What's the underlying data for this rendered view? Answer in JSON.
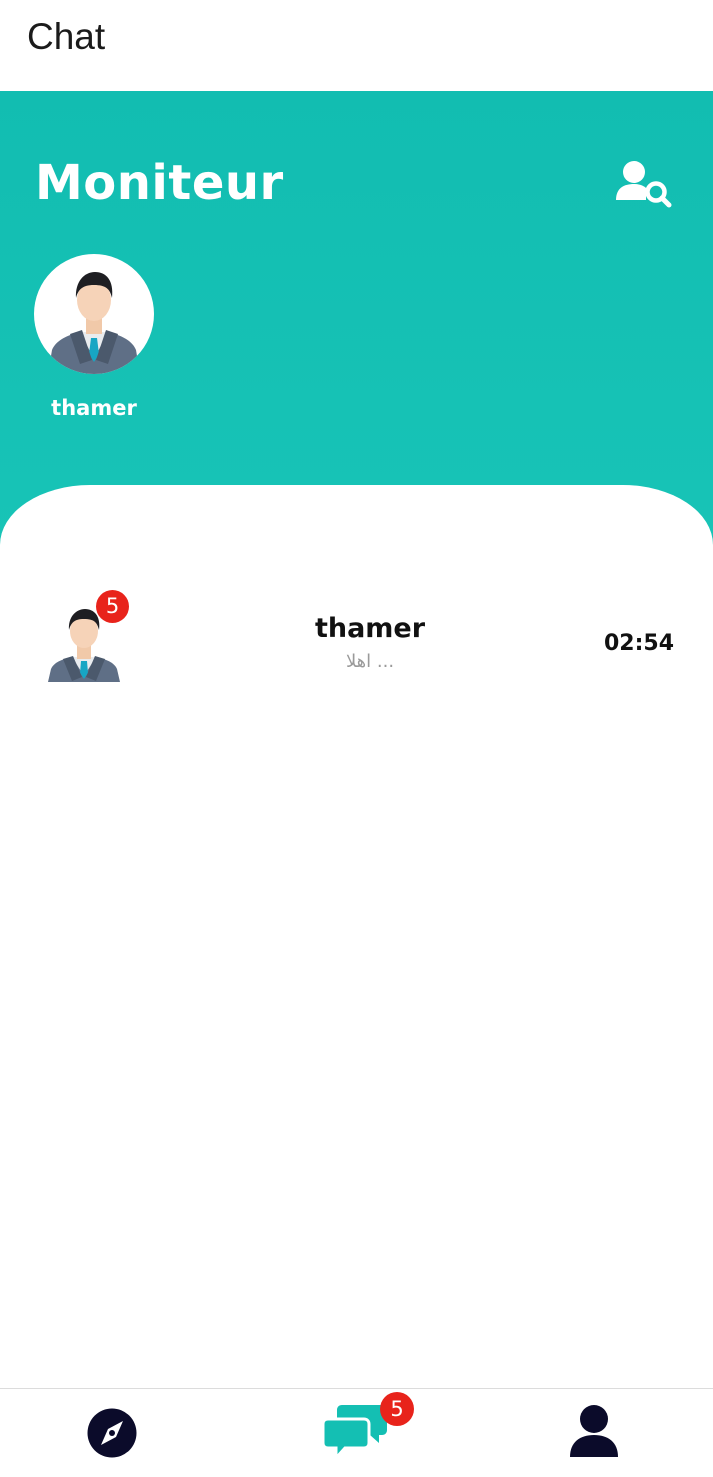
{
  "appbar": {
    "title": "Chat"
  },
  "hero": {
    "title": "Moniteur",
    "search_icon": "user-search-icon",
    "background_color": "#14bfb3"
  },
  "stories": [
    {
      "name": "thamer",
      "avatar_icon": "businessman-avatar-icon"
    }
  ],
  "conversations": [
    {
      "name": "thamer",
      "preview": "اهلا ...",
      "time": "02:54",
      "unread": "5",
      "avatar_icon": "businessman-avatar-icon"
    }
  ],
  "bottom_nav": {
    "items": [
      {
        "icon": "compass-icon",
        "color": "#0b0b2a"
      },
      {
        "icon": "chat-bubbles-icon",
        "color": "#14bfb3",
        "badge": "5"
      },
      {
        "icon": "person-icon",
        "color": "#0b0b2a"
      }
    ]
  },
  "colors": {
    "accent": "#14bfb3",
    "badge": "#e8231b",
    "dark_icon": "#0b0b2a"
  }
}
